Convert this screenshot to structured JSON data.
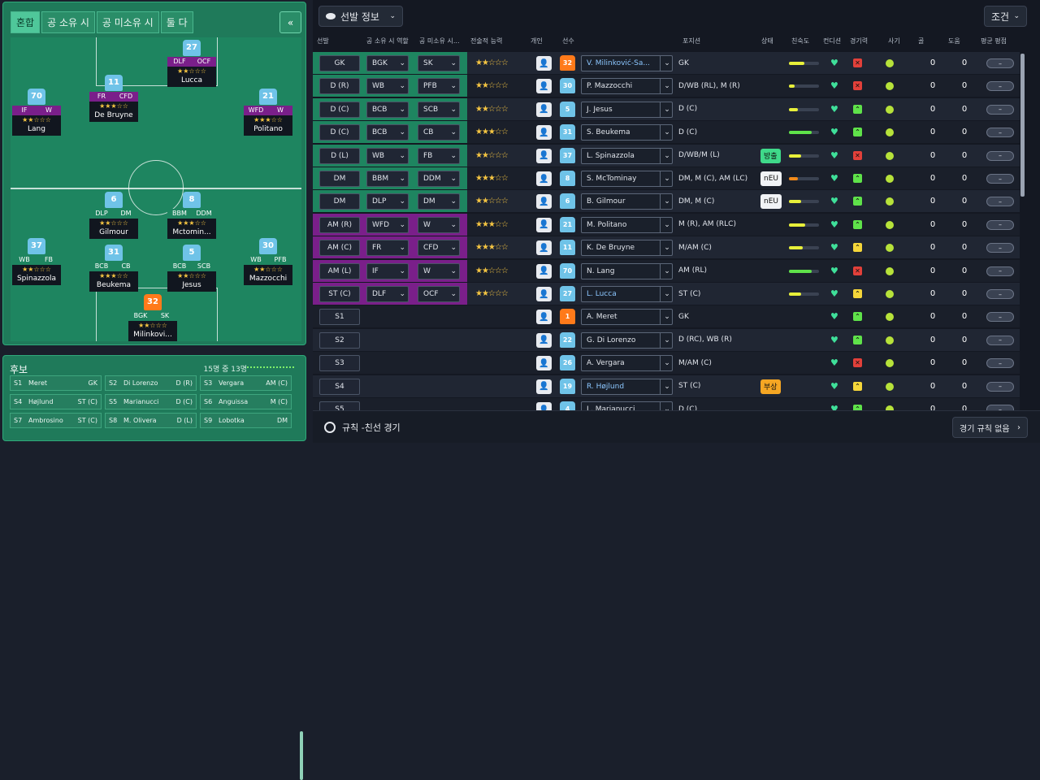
{
  "left": {
    "tabs": [
      "혼합",
      "공 소유 시",
      "공 미소유 시",
      "둘 다"
    ],
    "collapse_icon": "«",
    "pitch_players": [
      {
        "num": "27",
        "role1": "DLF",
        "role2": "OCF",
        "stars": "★★☆☆☆",
        "name": "Lucca",
        "color": "#7a1f8a",
        "gk": false
      },
      {
        "num": "11",
        "role1": "FR",
        "role2": "CFD",
        "stars": "★★★☆☆",
        "name": "De Bruyne",
        "color": "#7a1f8a",
        "gk": false
      },
      {
        "num": "70",
        "role1": "IF",
        "role2": "W",
        "stars": "★★☆☆☆",
        "name": "Lang",
        "color": "#7a1f8a",
        "gk": false
      },
      {
        "num": "21",
        "role1": "WFD",
        "role2": "W",
        "stars": "★★★☆☆",
        "name": "Politano",
        "color": "#7a1f8a",
        "gk": false
      },
      {
        "num": "6",
        "role1": "DLP",
        "role2": "DM",
        "stars": "★★☆☆☆",
        "name": "Gilmour",
        "color": "#1e8560",
        "gk": false
      },
      {
        "num": "8",
        "role1": "BBM",
        "role2": "DDM",
        "stars": "★★★☆☆",
        "name": "Mctomin...",
        "color": "#1e8560",
        "gk": false
      },
      {
        "num": "37",
        "role1": "WB",
        "role2": "FB",
        "stars": "★★☆☆☆",
        "name": "Spinazzola",
        "color": "#1e8560",
        "gk": false
      },
      {
        "num": "31",
        "role1": "BCB",
        "role2": "CB",
        "stars": "★★★☆☆",
        "name": "Beukema",
        "color": "#1e8560",
        "gk": false
      },
      {
        "num": "5",
        "role1": "BCB",
        "role2": "SCB",
        "stars": "★★☆☆☆",
        "name": "Jesus",
        "color": "#1e8560",
        "gk": false
      },
      {
        "num": "30",
        "role1": "WB",
        "role2": "PFB",
        "stars": "★★☆☆☆",
        "name": "Mazzocchi",
        "color": "#1e8560",
        "gk": false
      },
      {
        "num": "32",
        "role1": "BGK",
        "role2": "SK",
        "stars": "★★☆☆☆",
        "name": "Milinkovi...",
        "color": "#1e8560",
        "gk": true
      }
    ],
    "subs_title": "후보",
    "subs_count": "15명 중 13명",
    "subs": [
      {
        "n": "S1",
        "name": "Meret",
        "pos": "GK"
      },
      {
        "n": "S2",
        "name": "Di Lorenzo",
        "pos": "D (R)"
      },
      {
        "n": "S3",
        "name": "Vergara",
        "pos": "AM (C)"
      },
      {
        "n": "S4",
        "name": "Højlund",
        "pos": "ST (C)"
      },
      {
        "n": "S5",
        "name": "Marianucci",
        "pos": "D (C)"
      },
      {
        "n": "S6",
        "name": "Anguissa",
        "pos": "M (C)"
      },
      {
        "n": "S7",
        "name": "Ambrosino",
        "pos": "ST (C)"
      },
      {
        "n": "S8",
        "name": "M. Olivera",
        "pos": "D (L)"
      },
      {
        "n": "S9",
        "name": "Lobotka",
        "pos": "DM"
      }
    ]
  },
  "right": {
    "view_dropdown": "선발 정보",
    "filter_button": "조건",
    "headers": [
      "선발",
      "공 소유 시 역할",
      "공 미소유 시...",
      "전술적 능력",
      "개인",
      "선수",
      "포지션",
      "상태",
      "친숙도",
      "컨디션",
      "경기력",
      "사기",
      "골",
      "도움",
      "평균 평점"
    ],
    "rows": [
      {
        "slot": "GK",
        "r1": "BGK",
        "r2": "SK",
        "stars": "★★☆☆☆",
        "num": "32",
        "name": "V. Milinković-Sa...",
        "link": true,
        "pos": "GK",
        "status": "",
        "fam": 0.5,
        "famc": "#e8f03a",
        "perf": "x",
        "gk": true,
        "band": "#1e8560"
      },
      {
        "slot": "D (R)",
        "r1": "WB",
        "r2": "PFB",
        "stars": "★★☆☆☆",
        "num": "30",
        "name": "P. Mazzocchi",
        "link": false,
        "pos": "D/WB (RL), M (R)",
        "status": "",
        "fam": 0.2,
        "famc": "#e8f03a",
        "perf": "x",
        "gk": false,
        "band": "#1e8560"
      },
      {
        "slot": "D (C)",
        "r1": "BCB",
        "r2": "SCB",
        "stars": "★★☆☆☆",
        "num": "5",
        "name": "J. Jesus",
        "link": false,
        "pos": "D (C)",
        "status": "",
        "fam": 0.3,
        "famc": "#e8f03a",
        "perf": "u",
        "gk": false,
        "band": "#1e8560"
      },
      {
        "slot": "D (C)",
        "r1": "BCB",
        "r2": "CB",
        "stars": "★★★☆☆",
        "num": "31",
        "name": "S. Beukema",
        "link": false,
        "pos": "D (C)",
        "status": "",
        "fam": 0.75,
        "famc": "#5fe24a",
        "perf": "u",
        "gk": false,
        "band": "#1e8560"
      },
      {
        "slot": "D (L)",
        "r1": "WB",
        "r2": "FB",
        "stars": "★★☆☆☆",
        "num": "37",
        "name": "L. Spinazzola",
        "link": false,
        "pos": "D/WB/M (L)",
        "status": "방출",
        "statusc": "#3fd98a",
        "fam": 0.4,
        "famc": "#e8f03a",
        "perf": "x",
        "gk": false,
        "band": "#1e8560"
      },
      {
        "slot": "DM",
        "r1": "BBM",
        "r2": "DDM",
        "stars": "★★★☆☆",
        "num": "8",
        "name": "S. McTominay",
        "link": false,
        "pos": "DM, M (C), AM (LC)",
        "status": "nEU",
        "statusc": "#f1f3f6",
        "fam": 0.3,
        "famc": "#f28a1a",
        "perf": "u",
        "gk": false,
        "band": "#1e8560"
      },
      {
        "slot": "DM",
        "r1": "DLP",
        "r2": "DM",
        "stars": "★★☆☆☆",
        "num": "6",
        "name": "B. Gilmour",
        "link": false,
        "pos": "DM, M (C)",
        "status": "nEU",
        "statusc": "#f1f3f6",
        "fam": 0.4,
        "famc": "#e8f03a",
        "perf": "u",
        "gk": false,
        "band": "#1e8560"
      },
      {
        "slot": "AM (R)",
        "r1": "WFD",
        "r2": "W",
        "stars": "★★★☆☆",
        "num": "21",
        "name": "M. Politano",
        "link": false,
        "pos": "M (R), AM (RLC)",
        "status": "",
        "fam": 0.55,
        "famc": "#e8f03a",
        "perf": "u",
        "gk": false,
        "band": "#7a1f8a"
      },
      {
        "slot": "AM (C)",
        "r1": "FR",
        "r2": "CFD",
        "stars": "★★★☆☆",
        "num": "11",
        "name": "K. De Bruyne",
        "link": false,
        "pos": "M/AM (C)",
        "status": "",
        "fam": 0.45,
        "famc": "#e8f03a",
        "perf": "y",
        "gk": false,
        "band": "#7a1f8a"
      },
      {
        "slot": "AM (L)",
        "r1": "IF",
        "r2": "W",
        "stars": "★★☆☆☆",
        "num": "70",
        "name": "N. Lang",
        "link": false,
        "pos": "AM (RL)",
        "status": "",
        "fam": 0.75,
        "famc": "#5fe24a",
        "perf": "x",
        "gk": false,
        "band": "#7a1f8a"
      },
      {
        "slot": "ST (C)",
        "r1": "DLF",
        "r2": "OCF",
        "stars": "★★☆☆☆",
        "num": "27",
        "name": "L. Lucca",
        "link": true,
        "pos": "ST (C)",
        "status": "",
        "fam": 0.4,
        "famc": "#e8f03a",
        "perf": "y",
        "gk": false,
        "band": "#7a1f8a"
      },
      {
        "slot": "S1",
        "name": "A. Meret",
        "num": "1",
        "link": false,
        "pos": "GK",
        "status": "",
        "perf": "u",
        "gk": true
      },
      {
        "slot": "S2",
        "name": "G. Di Lorenzo",
        "num": "22",
        "link": false,
        "pos": "D (RC), WB (R)",
        "status": "",
        "perf": "u",
        "gk": false
      },
      {
        "slot": "S3",
        "name": "A. Vergara",
        "num": "26",
        "link": false,
        "pos": "M/AM (C)",
        "status": "",
        "perf": "x",
        "gk": false
      },
      {
        "slot": "S4",
        "name": "R. Højlund",
        "num": "19",
        "link": true,
        "pos": "ST (C)",
        "status": "부상",
        "statusc": "#f5a623",
        "perf": "y",
        "gk": false
      },
      {
        "slot": "S5",
        "name": "L. Marianucci",
        "num": "4",
        "link": false,
        "pos": "D (C)",
        "status": "",
        "perf": "u",
        "gk": false
      }
    ],
    "zero": "0",
    "dash": "–",
    "footer_label": "규칙 -친선 경기",
    "footer_button": "경기 규칙 없음"
  }
}
